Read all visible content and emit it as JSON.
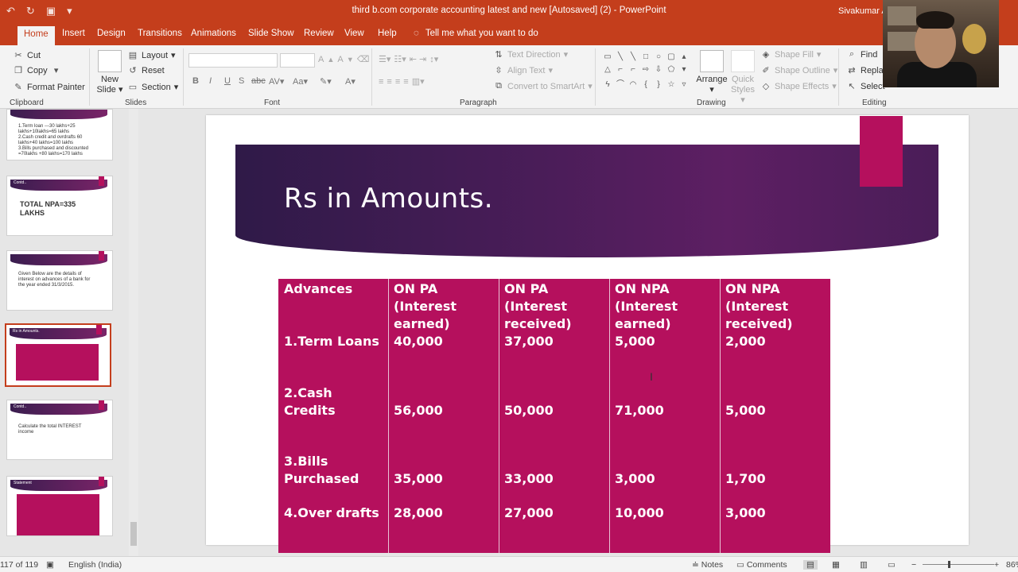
{
  "window": {
    "title": "third b.com corporate accounting latest and new [Autosaved] (2)  -  PowerPoint",
    "user": "Sivakumar A"
  },
  "ribbon_tabs": [
    "Home",
    "Insert",
    "Design",
    "Transitions",
    "Animations",
    "Slide Show",
    "Review",
    "View",
    "Help"
  ],
  "tell_me": "Tell me what you want to do",
  "clipboard": {
    "cut": "Cut",
    "copy": "Copy",
    "format_painter": "Format Painter",
    "label": "Clipboard"
  },
  "slides_group": {
    "new_slide_1": "New",
    "new_slide_2": "Slide",
    "layout": "Layout",
    "reset": "Reset",
    "section": "Section",
    "label": "Slides"
  },
  "font_group": {
    "label": "Font"
  },
  "paragraph_group": {
    "text_direction": "Text Direction",
    "align_text": "Align Text",
    "convert_smartart": "Convert to SmartArt",
    "label": "Paragraph"
  },
  "drawing_group": {
    "arrange": "Arrange",
    "quick_styles_1": "Quick",
    "quick_styles_2": "Styles",
    "shape_fill": "Shape Fill",
    "shape_outline": "Shape Outline",
    "shape_effects": "Shape Effects",
    "label": "Drawing"
  },
  "editing_group": {
    "find": "Find",
    "replace": "Replac",
    "select": "Select",
    "label": "Editing"
  },
  "thumbnails": [
    {
      "title": "",
      "text": "1.Term loan ---30 lakhs+25 lakhs+10lakhs=65 lakhs\n2.Cash credit and ovrdrafts 60 lakhs+40 lakhs=100 lakhs\n3.Bills purchased and discounted =70lakhs +80 lakhs=170 lakhs"
    },
    {
      "title": "Contd..",
      "text": "TOTAL NPA=335 LAKHS"
    },
    {
      "title": "",
      "text": "Given Below are the details of interest on advances of a bank for the year ended 31/3/2015."
    },
    {
      "title": "Rs in Amounts.",
      "text": ""
    },
    {
      "title": "Contd..",
      "text": "Calculate the total INTEREST income"
    },
    {
      "title": "Statement",
      "text": ""
    }
  ],
  "slide": {
    "title": "Rs in Amounts.",
    "table": {
      "headers": [
        "Advances",
        "ON PA\n(Interest\nearned)",
        "ON PA\n(Interest\nreceived)",
        "ON NPA\n(Interest\nearned)",
        "ON NPA\n(Interest\nreceived)"
      ],
      "rows": [
        [
          "1.Term Loans",
          "40,000",
          "37,000",
          "5,000",
          "2,000"
        ],
        [
          "2.Cash\nCredits",
          "56,000",
          "50,000",
          "71,000",
          "5,000"
        ],
        [
          "3.Bills\nPurchased",
          "35,000",
          "33,000",
          "3,000",
          "1,700"
        ],
        [
          "4.Over drafts",
          "28,000",
          "27,000",
          "10,000",
          "3,000"
        ]
      ]
    }
  },
  "status": {
    "slide_counter": "117 of 119",
    "language": "English (India)",
    "notes": "Notes",
    "comments": "Comments",
    "zoom": "86%"
  },
  "colors": {
    "accent": "#c43e1c",
    "table_fill": "#b5105d",
    "banner": "#4b1d59"
  }
}
